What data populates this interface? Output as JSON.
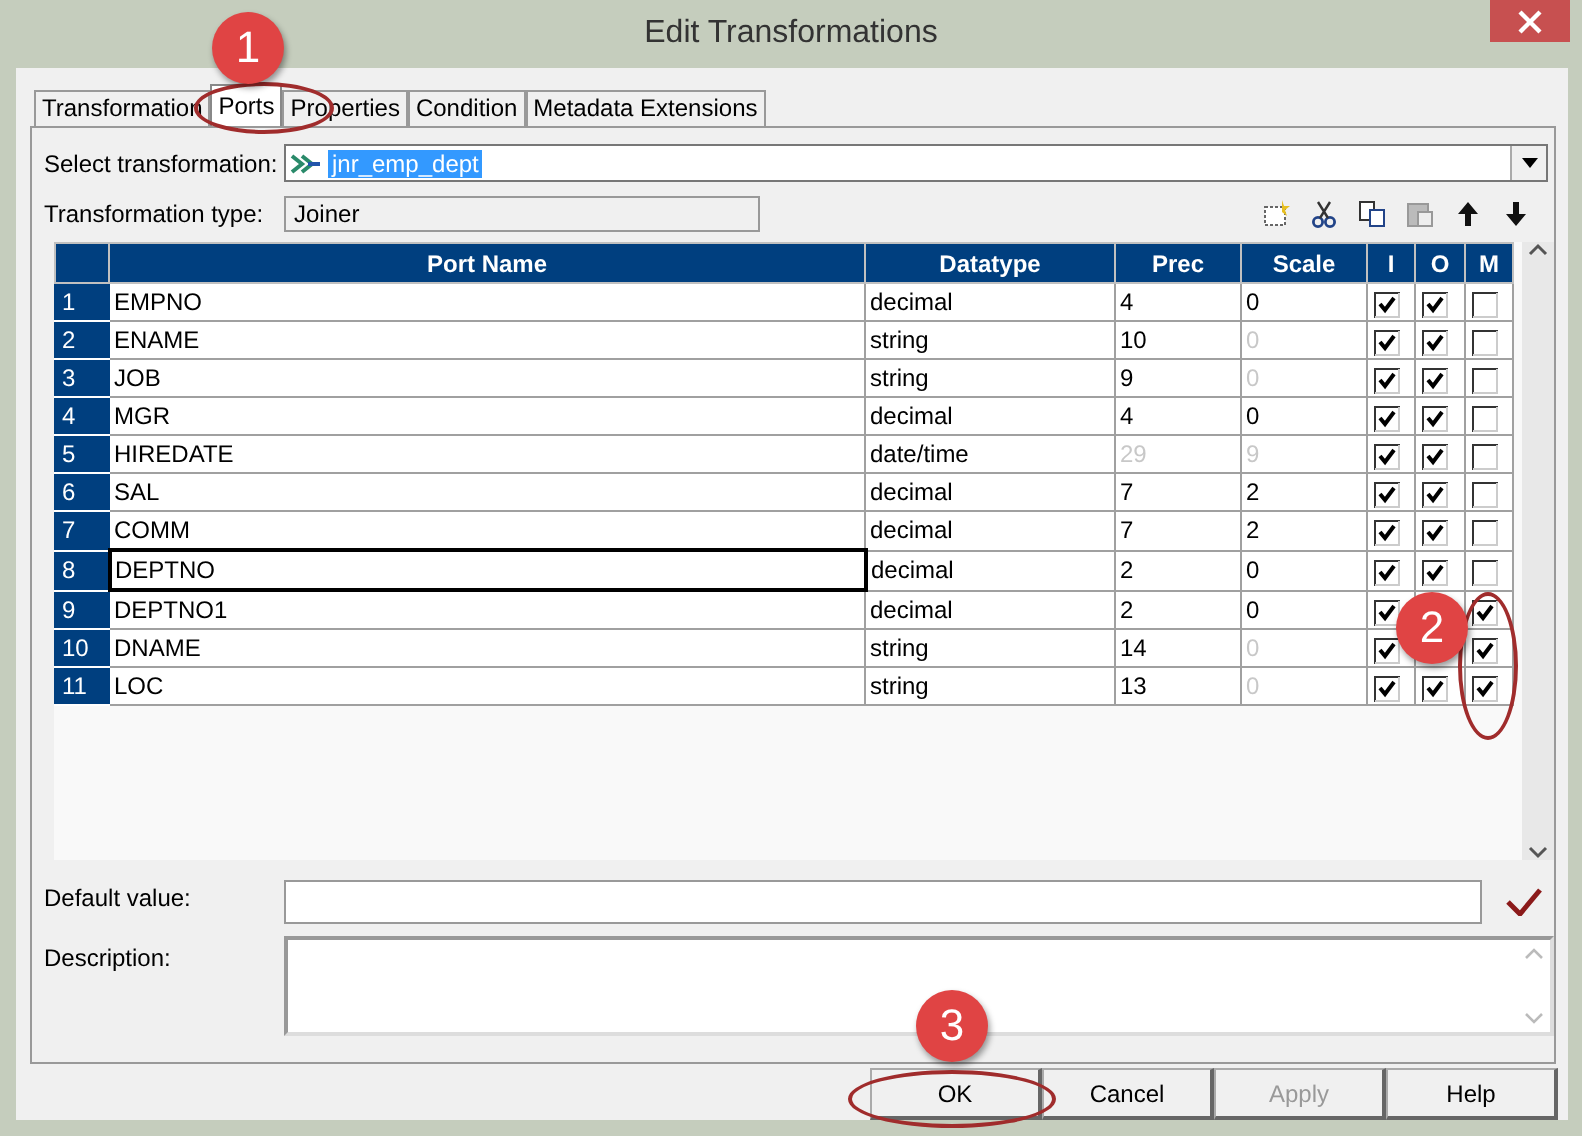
{
  "window": {
    "title": "Edit Transformations"
  },
  "tabs": [
    {
      "label": "Transformation",
      "selected": false
    },
    {
      "label": "Ports",
      "selected": true
    },
    {
      "label": "Properties",
      "selected": false
    },
    {
      "label": "Condition",
      "selected": false
    },
    {
      "label": "Metadata Extensions",
      "selected": false
    }
  ],
  "select_transformation": {
    "label": "Select transformation:",
    "value": "jnr_emp_dept",
    "value_selected": true
  },
  "transformation_type": {
    "label": "Transformation type:",
    "value": "Joiner"
  },
  "table": {
    "columns": [
      "Port Name",
      "Datatype",
      "Prec",
      "Scale",
      "I",
      "O",
      "M"
    ],
    "rows": [
      {
        "number": "1",
        "port_name": "EMPNO",
        "datatype": "decimal",
        "prec": "4",
        "prec_disabled": false,
        "scale": "0",
        "scale_disabled": false,
        "i": true,
        "o": true,
        "m": false,
        "selected": false
      },
      {
        "number": "2",
        "port_name": "ENAME",
        "datatype": "string",
        "prec": "10",
        "prec_disabled": false,
        "scale": "0",
        "scale_disabled": true,
        "i": true,
        "o": true,
        "m": false,
        "selected": false
      },
      {
        "number": "3",
        "port_name": "JOB",
        "datatype": "string",
        "prec": "9",
        "prec_disabled": false,
        "scale": "0",
        "scale_disabled": true,
        "i": true,
        "o": true,
        "m": false,
        "selected": false
      },
      {
        "number": "4",
        "port_name": "MGR",
        "datatype": "decimal",
        "prec": "4",
        "prec_disabled": false,
        "scale": "0",
        "scale_disabled": false,
        "i": true,
        "o": true,
        "m": false,
        "selected": false
      },
      {
        "number": "5",
        "port_name": "HIREDATE",
        "datatype": "date/time",
        "prec": "29",
        "prec_disabled": true,
        "scale": "9",
        "scale_disabled": true,
        "i": true,
        "o": true,
        "m": false,
        "selected": false
      },
      {
        "number": "6",
        "port_name": "SAL",
        "datatype": "decimal",
        "prec": "7",
        "prec_disabled": false,
        "scale": "2",
        "scale_disabled": false,
        "i": true,
        "o": true,
        "m": false,
        "selected": false
      },
      {
        "number": "7",
        "port_name": "COMM",
        "datatype": "decimal",
        "prec": "7",
        "prec_disabled": false,
        "scale": "2",
        "scale_disabled": false,
        "i": true,
        "o": true,
        "m": false,
        "selected": false
      },
      {
        "number": "8",
        "port_name": "DEPTNO",
        "datatype": "decimal",
        "prec": "2",
        "prec_disabled": false,
        "scale": "0",
        "scale_disabled": false,
        "i": true,
        "o": true,
        "m": false,
        "selected": true
      },
      {
        "number": "9",
        "port_name": "DEPTNO1",
        "datatype": "decimal",
        "prec": "2",
        "prec_disabled": false,
        "scale": "0",
        "scale_disabled": false,
        "i": true,
        "m": true,
        "selected": false
      },
      {
        "number": "10",
        "port_name": "DNAME",
        "datatype": "string",
        "prec": "14",
        "prec_disabled": false,
        "scale": "0",
        "scale_disabled": true,
        "i": true,
        "m": true,
        "selected": false
      },
      {
        "number": "11",
        "port_name": "LOC",
        "datatype": "string",
        "prec": "13",
        "prec_disabled": false,
        "scale": "0",
        "scale_disabled": true,
        "i": true,
        "o": true,
        "m": true,
        "selected": false
      }
    ]
  },
  "default_value": {
    "label": "Default value:"
  },
  "description": {
    "label": "Description:"
  },
  "buttons": [
    {
      "label": "OK",
      "disabled": false
    },
    {
      "label": "Cancel",
      "disabled": false
    },
    {
      "label": "Apply",
      "disabled": true
    },
    {
      "label": "Help",
      "disabled": false
    }
  ],
  "callouts": [
    "1",
    "2",
    "3"
  ]
}
